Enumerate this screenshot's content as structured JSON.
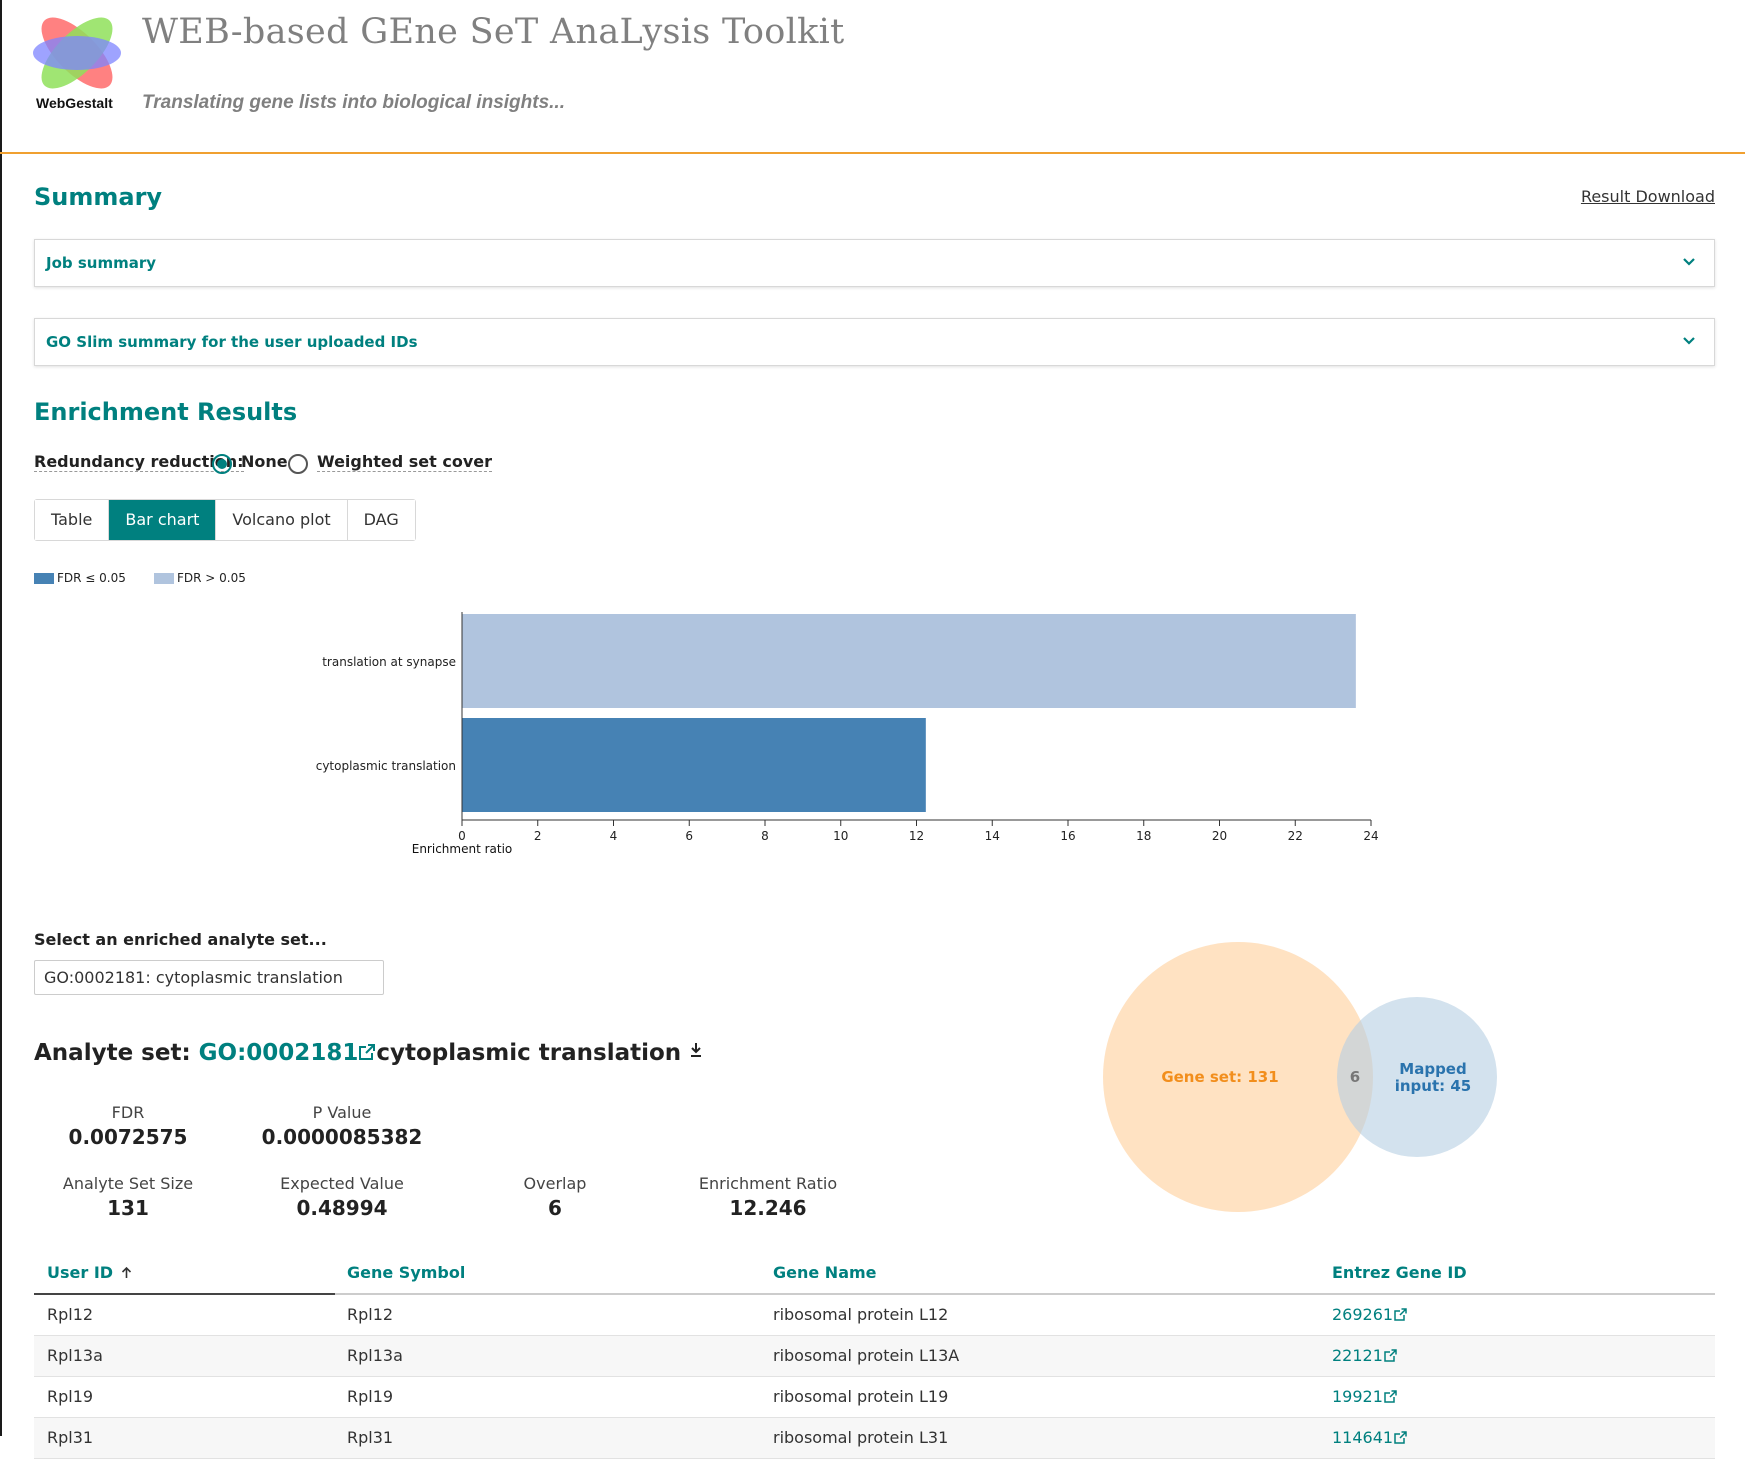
{
  "header": {
    "logo_text": "WebGestalt",
    "title": "WEB-based GEne SeT AnaLysis Toolkit",
    "subtitle": "Translating gene lists into biological insights..."
  },
  "summary": {
    "heading": "Summary",
    "download_label": "Result Download",
    "panels": [
      {
        "label": "Job summary"
      },
      {
        "label": "GO Slim summary for the user uploaded IDs"
      }
    ]
  },
  "enrichment": {
    "heading": "Enrichment Results",
    "redundancy_label": "Redundancy reduction:",
    "options": [
      {
        "label": "None",
        "selected": true
      },
      {
        "label": "Weighted set cover",
        "selected": false
      }
    ],
    "tabs": [
      {
        "label": "Table",
        "active": false
      },
      {
        "label": "Bar chart",
        "active": true
      },
      {
        "label": "Volcano plot",
        "active": false
      },
      {
        "label": "DAG",
        "active": false
      }
    ],
    "legend": [
      {
        "label": "FDR ≤ 0.05",
        "color": "#4682b4"
      },
      {
        "label": "FDR > 0.05",
        "color": "#b0c4de"
      }
    ]
  },
  "chart_data": {
    "type": "bar",
    "orientation": "horizontal",
    "categories": [
      "translation at synapse",
      "cytoplasmic translation"
    ],
    "values": [
      23.6,
      12.246
    ],
    "colors": [
      "#b0c4de",
      "#4682b4"
    ],
    "xlabel": "Enrichment ratio",
    "xlim": [
      0,
      24
    ],
    "xticks": [
      0,
      2,
      4,
      6,
      8,
      10,
      12,
      14,
      16,
      18,
      20,
      22,
      24
    ]
  },
  "selector": {
    "label": "Select an enriched analyte set...",
    "value": "GO:0002181: cytoplasmic translation"
  },
  "analyte": {
    "prefix": "Analyte set:",
    "id": "GO:0002181",
    "name": "cytoplasmic translation",
    "stats": [
      {
        "key": "FDR",
        "value": "0.0072575"
      },
      {
        "key": "P Value",
        "value": "0.0000085382"
      },
      {
        "key": "Analyte Set Size",
        "value": "131"
      },
      {
        "key": "Expected Value",
        "value": "0.48994"
      },
      {
        "key": "Overlap",
        "value": "6"
      },
      {
        "key": "Enrichment Ratio",
        "value": "12.246"
      }
    ]
  },
  "venn": {
    "gene_set_label": "Gene set: 131",
    "overlap_label": "6",
    "mapped_line1": "Mapped",
    "mapped_line2": "input: 45",
    "gene_set_color": "#ffe0bd",
    "mapped_color": "#c9dbea"
  },
  "gene_table": {
    "columns": [
      "User ID",
      "Gene Symbol",
      "Gene Name",
      "Entrez Gene ID"
    ],
    "rows": [
      [
        "Rpl12",
        "Rpl12",
        "ribosomal protein L12",
        "269261"
      ],
      [
        "Rpl13a",
        "Rpl13a",
        "ribosomal protein L13A",
        "22121"
      ],
      [
        "Rpl19",
        "Rpl19",
        "ribosomal protein L19",
        "19921"
      ],
      [
        "Rpl31",
        "Rpl31",
        "ribosomal protein L31",
        "114641"
      ]
    ]
  }
}
